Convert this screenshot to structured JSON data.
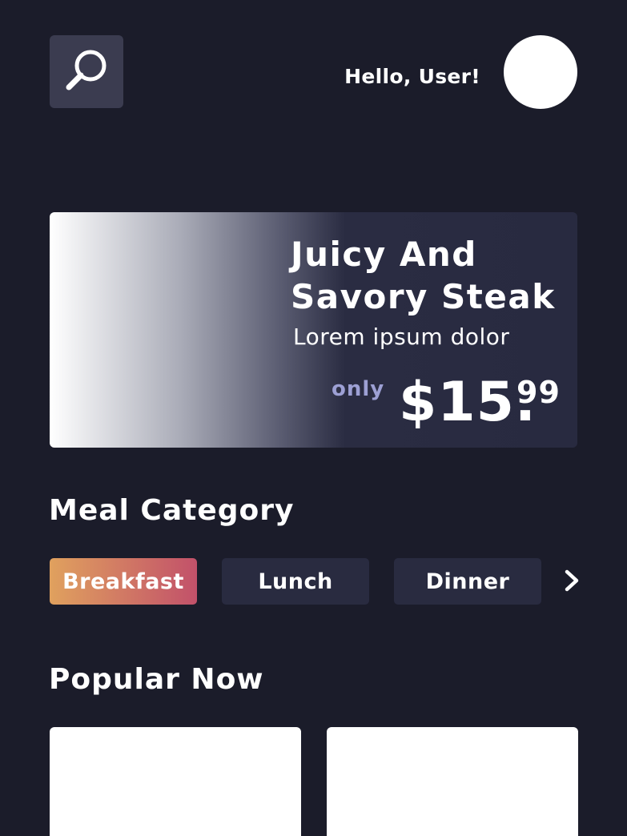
{
  "header": {
    "greeting": "Hello, User!",
    "search_icon": "search-icon"
  },
  "promo": {
    "title": "Juicy And\nSavory Steak",
    "subtitle": "Lorem ipsum dolor",
    "only_label": "only",
    "price_main": "$15.",
    "price_cents": "99"
  },
  "meal_category": {
    "title": "Meal Category",
    "items": [
      {
        "label": "Breakfast",
        "active": true
      },
      {
        "label": "Lunch",
        "active": false
      },
      {
        "label": "Dinner",
        "active": false
      }
    ],
    "next_icon": "chevron-right-icon"
  },
  "popular": {
    "title": "Popular Now"
  },
  "colors": {
    "background": "#1b1c2a",
    "accent_gradient_start": "#e0a15e",
    "accent_gradient_end": "#c2516a",
    "chip_background": "#292b40",
    "only_label": "#9da0d4"
  }
}
